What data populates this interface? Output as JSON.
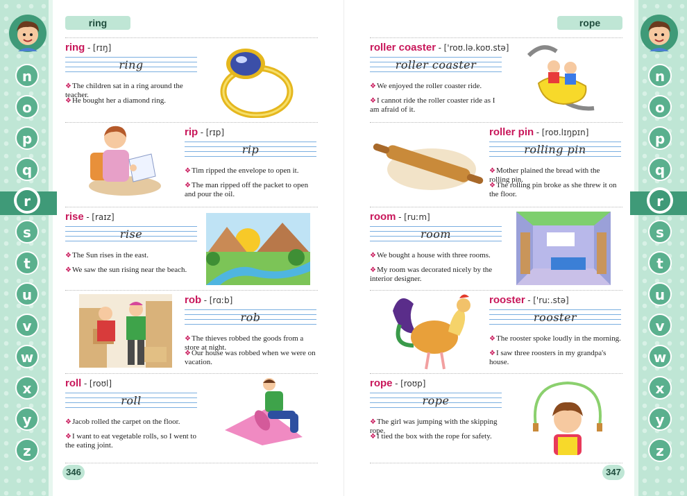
{
  "left_page": {
    "guide_word": "ring",
    "page_number": "346",
    "letters": [
      "n",
      "o",
      "p",
      "q",
      "r",
      "s",
      "t",
      "u",
      "v",
      "w",
      "x",
      "y",
      "z"
    ],
    "active_letter": "r"
  },
  "right_page": {
    "guide_word": "rope",
    "page_number": "347",
    "letters": [
      "n",
      "o",
      "p",
      "q",
      "r",
      "s",
      "t",
      "u",
      "v",
      "w",
      "x",
      "y",
      "z"
    ],
    "active_letter": "r"
  },
  "entries": [
    {
      "word": "ring",
      "pron": "[rɪŋ]",
      "cursive": "ring",
      "sentences": [
        "The children sat in a ring around the teacher.",
        "He bought her a diamond ring."
      ],
      "picture": "ring-illustration"
    },
    {
      "word": "rip",
      "pron": "[rɪp]",
      "cursive": "rip",
      "sentences": [
        "Tim ripped the envelope to open it.",
        "The man ripped off the packet to open and pour the oil."
      ],
      "picture": "boy-ripping-envelope-illustration"
    },
    {
      "word": "rise",
      "pron": "[raɪz]",
      "cursive": "rise",
      "sentences": [
        "The Sun rises in the east.",
        "We saw the sun rising near the beach."
      ],
      "picture": "sunrise-landscape-illustration"
    },
    {
      "word": "rob",
      "pron": "[rɑːb]",
      "cursive": "rob",
      "sentences": [
        "The thieves robbed the goods from a store at night.",
        "Our house was robbed when we were on vacation."
      ],
      "picture": "thieves-illustration"
    },
    {
      "word": "roll",
      "pron": "[roʊl]",
      "cursive": "roll",
      "sentences": [
        "Jacob rolled the carpet on the floor.",
        "I want to eat vegetable rolls, so I went to the eating joint."
      ],
      "picture": "man-rolling-carpet-illustration"
    },
    {
      "word": "roller coaster",
      "pron": "['roʊ.lə.koʊ.stə]",
      "cursive": "roller coaster",
      "sentences": [
        "We enjoyed the roller coaster ride.",
        "I cannot ride the roller coaster ride as I am afraid of it."
      ],
      "picture": "roller-coaster-illustration"
    },
    {
      "word": "roller pin",
      "pron": "[roʊ.lɪŋpɪn]",
      "cursive": "rolling pin",
      "sentences": [
        "Mother plained the bread with the rolling pin.",
        "The rolling pin broke as she threw it on the floor."
      ],
      "picture": "rolling-pin-illustration"
    },
    {
      "word": "room",
      "pron": "[ruːm]",
      "cursive": "room",
      "sentences": [
        "We bought a house with three rooms.",
        "My room was decorated nicely by the interior designer."
      ],
      "picture": "bedroom-illustration"
    },
    {
      "word": "rooster",
      "pron": "['ruː.stə]",
      "cursive": "rooster",
      "sentences": [
        "The rooster spoke loudly in the morning.",
        "I saw three roosters in my grandpa's house."
      ],
      "picture": "rooster-illustration"
    },
    {
      "word": "rope",
      "pron": "[roʊp]",
      "cursive": "rope",
      "sentences": [
        "The girl was jumping with the skipping rope.",
        "I tied the box with the rope for safety."
      ],
      "picture": "girl-skipping-rope-illustration"
    }
  ],
  "colors": {
    "headword": "#c8175a",
    "strip": "#bfe6d5",
    "letter_circle": "#5ab08e",
    "guide_line": "#79aee0"
  },
  "bullet_glyph": "❖"
}
